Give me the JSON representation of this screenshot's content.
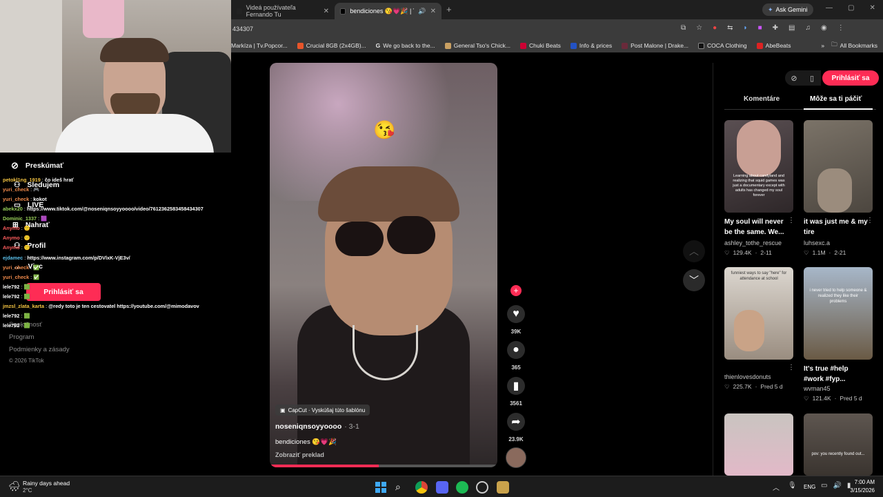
{
  "browser": {
    "tabs": [
      {
        "label": "Videá používateľa Fernando Tu"
      },
      {
        "label": "bendiciones 😘💗🎉 | Tik"
      }
    ],
    "new_tab_label": "+",
    "url": "434307",
    "gemini_label": "Ask Gemini",
    "bookmarks": [
      {
        "label": "Markíza | Tv.Popcor..."
      },
      {
        "label": "Crucial 8GB (2x4GB)..."
      },
      {
        "label": "We go back to the..."
      },
      {
        "label": "General Tso's Chick..."
      },
      {
        "label": "Chuki Beats"
      },
      {
        "label": "Info & prices"
      },
      {
        "label": "Post Malone | Drake..."
      },
      {
        "label": "COCA Clothing"
      },
      {
        "label": "AbeBeats"
      }
    ],
    "all_bookmarks_label": "All Bookmarks"
  },
  "sidebar": {
    "nav": [
      {
        "label": "Preskúmať"
      },
      {
        "label": "Sledujem"
      },
      {
        "label": "LIVE"
      },
      {
        "label": "Nahrať"
      },
      {
        "label": "Profil"
      },
      {
        "label": "Viac"
      }
    ],
    "login_label": "Prihlásiť sa",
    "footer": [
      "Spoločnosť",
      "Program",
      "Podmienky a zásady"
    ],
    "copyright": "© 2026 TikTok"
  },
  "chat": [
    {
      "user": "petokl1ng_1919",
      "msg": "čo ideš hrať",
      "color": "#f5c542"
    },
    {
      "user": "yuri_check",
      "msg": "🎮",
      "color": "#f08a4b"
    },
    {
      "user": "yuri_check",
      "msg": "kokot",
      "color": "#f08a4b"
    },
    {
      "user": "abekx20",
      "msg": "https://www.tiktok.com/@noseniqnsoyyoooo/video/7612362583458434307",
      "color": "#9ad15a"
    },
    {
      "user": "Dominic_1337",
      "msg": "🟪",
      "color": "#9ad15a"
    },
    {
      "user": "Anymo",
      "msg": "🙂",
      "color": "#ff5d5d"
    },
    {
      "user": "Anymo",
      "msg": "🙂",
      "color": "#ff5d5d"
    },
    {
      "user": "Anymo",
      "msg": "🙂",
      "color": "#ff5d5d"
    },
    {
      "user": "ejdamec",
      "msg": "https://www.instagram.com/p/DVlxK-VjE3v/",
      "color": "#5bc0eb"
    },
    {
      "user": "yuri_check",
      "msg": "✅",
      "color": "#f08a4b"
    },
    {
      "user": "yuri_check",
      "msg": "✅",
      "color": "#f08a4b"
    },
    {
      "user": "lele792",
      "msg": "🟩",
      "color": "#ffffff"
    },
    {
      "user": "lele792",
      "msg": "🟩",
      "color": "#ffffff"
    },
    {
      "user": "jmzsl_zlata_karta",
      "msg": "@redy toto je ten cestovatel https://youtube.com/@mimodavov",
      "color": "#f5c542"
    },
    {
      "user": "lele792",
      "msg": "🟩",
      "color": "#ffffff"
    },
    {
      "user": "lele792",
      "msg": "🟩",
      "color": "#ffffff"
    }
  ],
  "video": {
    "capcut_label": "CapCut · Vyskúšaj túto šablónu",
    "author": "noseniqnsoyyoooo",
    "date": "· 3-1",
    "caption": "bendiciones 😘💗🎉",
    "translate_label": "Zobraziť preklad",
    "likes": "39K",
    "comments": "365",
    "saves": "3561",
    "shares": "23.9K"
  },
  "right_panel": {
    "login_label": "Prihlásiť sa",
    "tabs": [
      {
        "label": "Komentáre"
      },
      {
        "label": "Môže sa ti páčiť"
      }
    ],
    "cards": [
      {
        "title": "My soul will never be the same. We...",
        "author": "ashley_tothe_rescue",
        "likes": "129.4K",
        "age": "2-11",
        "overlay": "Learning about candyland and realizing that squid games was just a documentary except with adults has changed my soul forever"
      },
      {
        "title": "it was just me & my tire",
        "author": "luhsexc.a",
        "likes": "1.1M",
        "age": "2-21",
        "overlay": ""
      },
      {
        "title": "",
        "author": "thienlovesdonuts",
        "likes": "225.7K",
        "age": "Pred 5 d",
        "overlay": "funniest ways to say \"here\" for attendance at school"
      },
      {
        "title": "It's true #help #work #fyp...",
        "author": "wvman45",
        "likes": "121.4K",
        "age": "Pred 5 d",
        "overlay": "i never tried to help someone & realized they like their problems"
      },
      {
        "title": "",
        "author": "",
        "likes": "",
        "age": "",
        "overlay": ""
      },
      {
        "title": "",
        "author": "",
        "likes": "",
        "age": "",
        "overlay": "pov: you recently found out..."
      }
    ]
  },
  "taskbar": {
    "weather_title": "Rainy days ahead",
    "weather_temp": "2°C",
    "lang": "ENG",
    "time": "7:00 AM",
    "date": "3/15/2026"
  },
  "colors": {
    "tiktok_pink": "#fe2c55",
    "chrome_dark": "#1f1f1f",
    "chrome_mid": "#3b3b3b"
  }
}
